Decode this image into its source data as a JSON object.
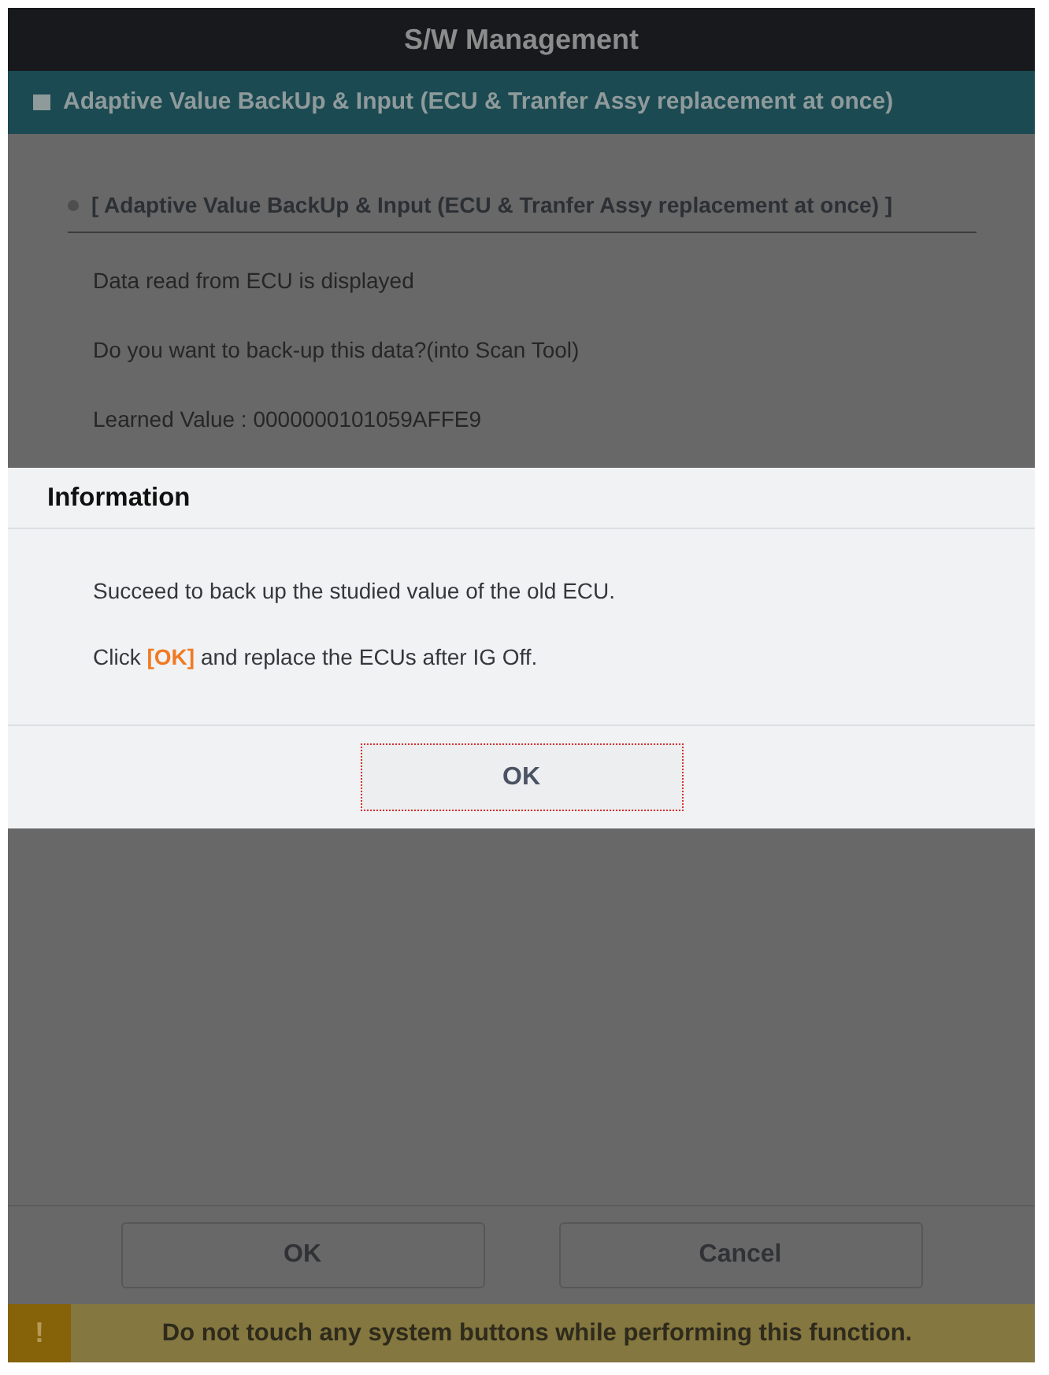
{
  "window": {
    "title": "S/W Management"
  },
  "section_bar": {
    "title": "Adaptive Value BackUp & Input (ECU & Tranfer Assy replacement at once)"
  },
  "content": {
    "heading": "[ Adaptive Value BackUp & Input (ECU & Tranfer Assy replacement at once) ]",
    "lines": [
      "Data read from ECU is displayed",
      "Do you want to back-up this data?(into Scan Tool)",
      "Learned Value : 0000000101059AFFE9"
    ]
  },
  "dialog": {
    "title": "Information",
    "lines": [
      "Succeed to back up the studied value of the old ECU.",
      "Click **[OK]** and replace the ECUs after IG Off."
    ],
    "button": {
      "label": "OK",
      "focused": true
    }
  },
  "buttons": [
    {
      "label": "OK"
    },
    {
      "label": "Cancel"
    }
  ],
  "warning": {
    "icon": "!",
    "text": "Do not touch any system buttons while performing this function."
  }
}
